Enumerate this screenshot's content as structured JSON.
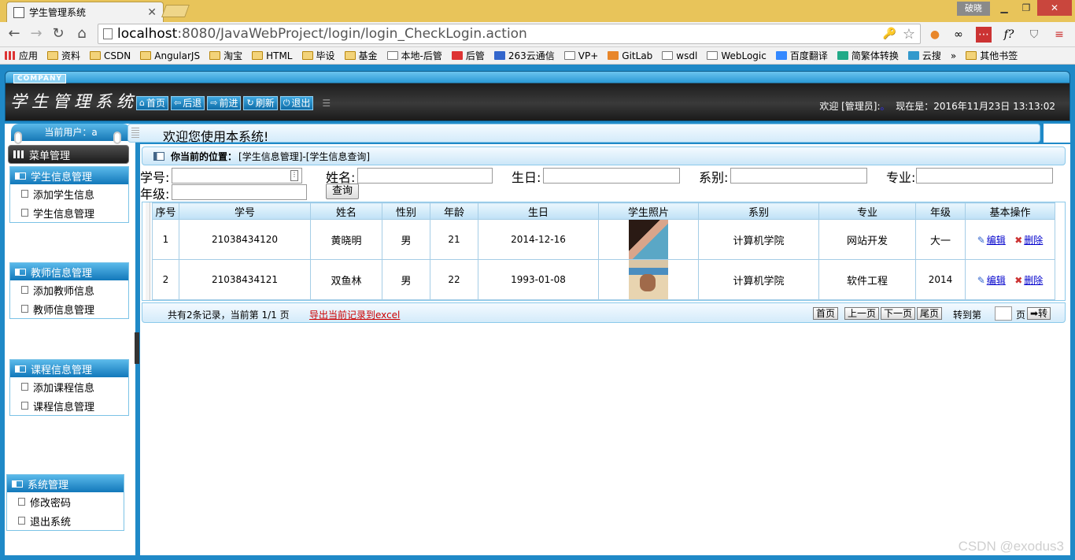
{
  "browser": {
    "tab_title": "学生管理系统",
    "window_user": "破晓",
    "url_host": "localhost",
    "url_rest": ":8080/JavaWebProject/login/login_CheckLogin.action",
    "bookmarks": [
      "应用",
      "资料",
      "CSDN",
      "AngularJS",
      "淘宝",
      "HTML",
      "毕设",
      "基金",
      "本地-后管",
      "后管",
      "263云通信",
      "VP+",
      "GitLab",
      "wsdl",
      "WebLogic",
      "百度翻译",
      "简繁体转换",
      "云搜",
      "»",
      "其他书签"
    ]
  },
  "header": {
    "company": "COMPANY",
    "logo": "学生管理系统",
    "nav": [
      {
        "icon": "⌂",
        "label": "首页"
      },
      {
        "icon": "⇦",
        "label": "后退"
      },
      {
        "icon": "⇨",
        "label": "前进"
      },
      {
        "icon": "↻",
        "label": "刷新"
      },
      {
        "icon": "⏻",
        "label": "退出"
      }
    ],
    "welcome_text": "欢迎 [管理员]:",
    "welcome_dot": "。",
    "time_text": "现在是：2016年11月23日 13:13:02"
  },
  "sidebar": {
    "current_user": "当前用户：a",
    "menu_title": "菜单管理",
    "groups": [
      {
        "title": "学生信息管理",
        "items": [
          "添加学生信息",
          "学生信息管理"
        ]
      },
      {
        "title": "教师信息管理",
        "items": [
          "添加教师信息",
          "教师信息管理"
        ]
      },
      {
        "title": "课程信息管理",
        "items": [
          "添加课程信息",
          "课程信息管理"
        ]
      },
      {
        "title": "系统管理",
        "items": [
          "修改密码",
          "退出系统"
        ]
      }
    ]
  },
  "content": {
    "welcome": "欢迎您使用本系统!",
    "location_label": "你当前的位置：",
    "location_value": "[学生信息管理]-[学生信息查询]",
    "filters": {
      "xuehao": "学号:",
      "xingming": "姓名:",
      "shengri": "生日:",
      "xibie": "系别:",
      "zhuanye": "专业:",
      "nianji": "年级:"
    },
    "query_button": "查询",
    "columns": [
      "序号",
      "学号",
      "姓名",
      "性别",
      "年龄",
      "生日",
      "学生照片",
      "系别",
      "专业",
      "年级",
      "基本操作"
    ],
    "rows": [
      {
        "no": "1",
        "id": "21038434120",
        "name": "黄晓明",
        "gender": "男",
        "age": "21",
        "birthday": "2014-12-16",
        "dept": "计算机学院",
        "major": "网站开发",
        "grade": "大一"
      },
      {
        "no": "2",
        "id": "21038434121",
        "name": "双鱼林",
        "gender": "男",
        "age": "22",
        "birthday": "1993-01-08",
        "dept": "计算机学院",
        "major": "软件工程",
        "grade": "2014"
      }
    ],
    "edit_label": "编辑",
    "delete_label": "删除",
    "pager": {
      "info": "共有2条记录，当前第 1/1 页",
      "export": "导出当前记录到excel",
      "first": "首页",
      "prev": "上一页",
      "next": "下一页",
      "last": "尾页",
      "goto": "转到第",
      "page_unit": "页",
      "go": "➡转"
    }
  },
  "watermark": "CSDN @exodus3"
}
